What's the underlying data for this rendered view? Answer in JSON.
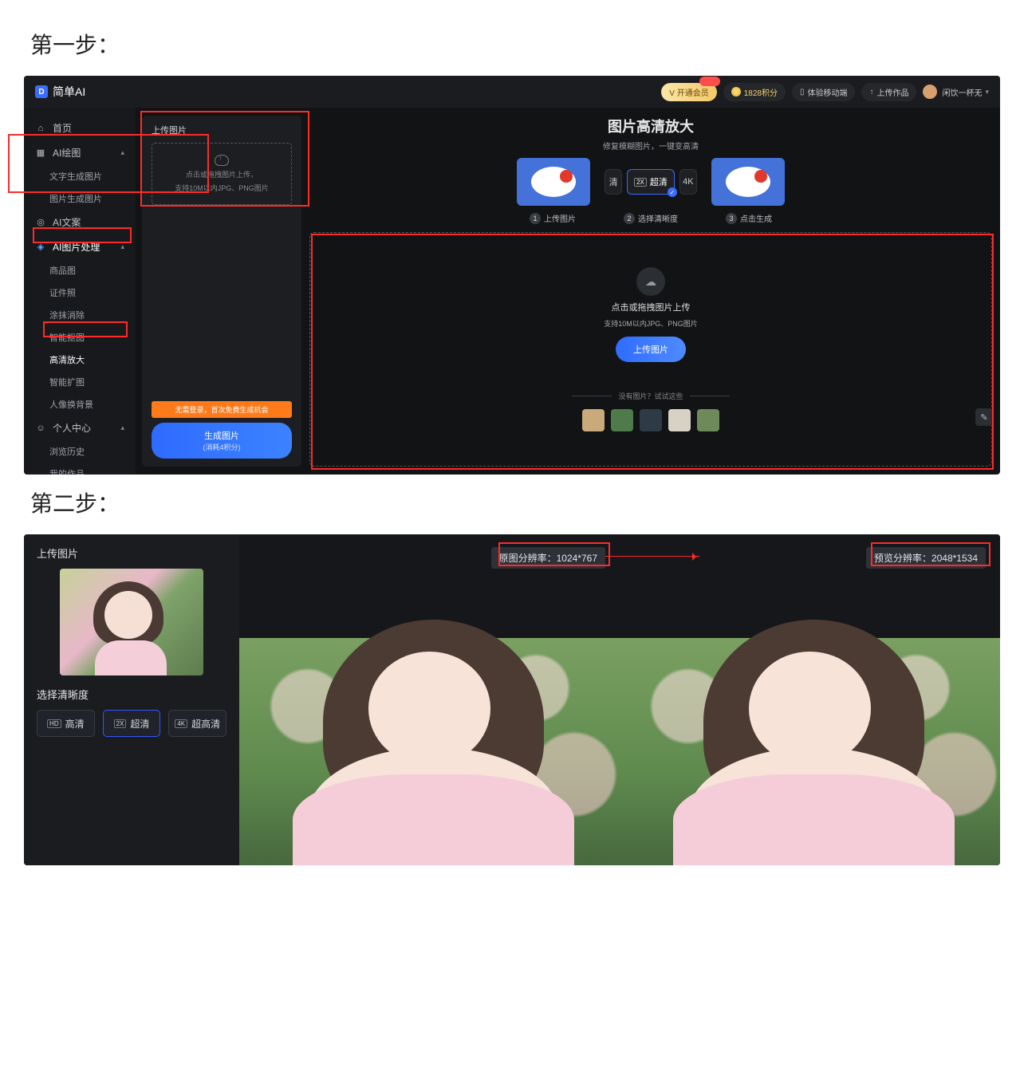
{
  "step_labels": {
    "one": "第一步：",
    "two": "第二步："
  },
  "header": {
    "logo_text": "简单AI",
    "vip_btn": "V 开通会员",
    "points": "1828积分",
    "mobile_btn": "体验移动端",
    "upload_btn": "上传作品",
    "username": "闲饮一杯无"
  },
  "sidebar": {
    "home": "首页",
    "ai_draw": "AI绘图",
    "ai_draw_subs": [
      "文字生成图片",
      "图片生成图片"
    ],
    "ai_write": "AI文案",
    "ai_image": "AI图片处理",
    "ai_image_subs": [
      "商品图",
      "证件照",
      "涂抹消除",
      "智能抠图",
      "高清放大",
      "智能扩图",
      "人像换背景"
    ],
    "personal": "个人中心",
    "personal_subs": [
      "浏览历史",
      "我的作品"
    ]
  },
  "upload_col": {
    "title": "上传图片",
    "drop_line1": "点击或拖拽图片上传，",
    "drop_line2": "支持10M以内JPG、PNG图片",
    "promo": "无需登录，首次免费生成机会",
    "gen_btn": "生成图片",
    "gen_sub": "(消耗4积分)"
  },
  "main": {
    "title": "图片高清放大",
    "subtitle": "修复模糊图片，一键变高清",
    "mode_hd": "清",
    "mode_2x": "超清",
    "mode_4k": "4K",
    "steps": [
      "上传图片",
      "选择清晰度",
      "点击生成"
    ],
    "drop_title": "点击或拖拽图片上传",
    "drop_sub": "支持10M以内JPG、PNG图片",
    "upload_btn": "上传图片",
    "sample_hint": "没有图片？试试这些"
  },
  "step2": {
    "panel_title": "上传图片",
    "section_label": "选择清晰度",
    "opts": {
      "hd": "高清",
      "uhd": "超清",
      "uuhd": "超高清",
      "hd_tag": "HD",
      "uhd_tag": "2X",
      "uuhd_tag": "4K"
    },
    "orig_res": "原图分辨率：1024*767",
    "preview_res": "预览分辨率：2048*1534"
  }
}
